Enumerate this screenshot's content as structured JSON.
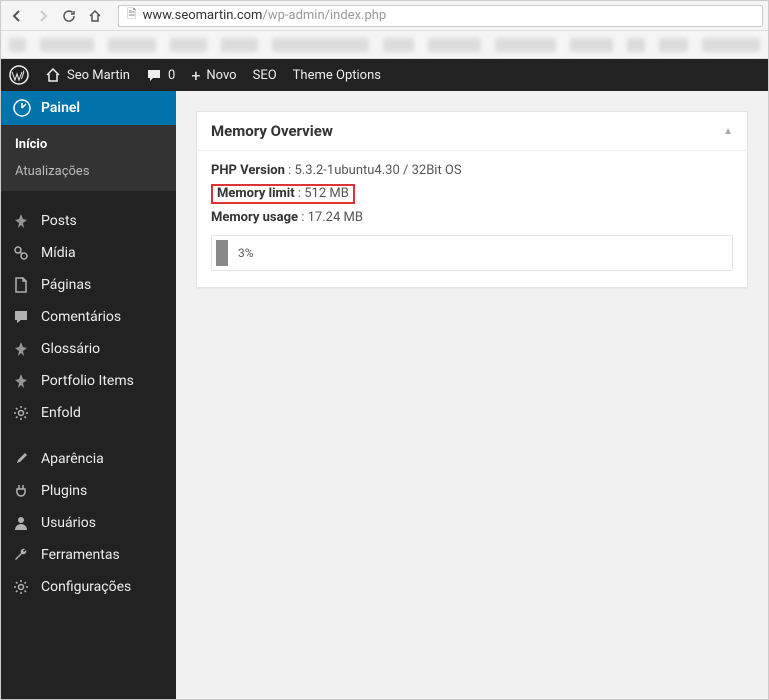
{
  "url": {
    "domain": "www.seomartin.com",
    "path": "/wp-admin/index.php"
  },
  "adminbar": {
    "site_name": "Seo Martin",
    "comments_count": "0",
    "new_label": "Novo",
    "seo_label": "SEO",
    "theme_options_label": "Theme Options"
  },
  "sidebar": {
    "dashboard": "Painel",
    "submenu": {
      "home": "Início",
      "updates": "Atualizações"
    },
    "items": [
      {
        "icon": "pin",
        "label": "Posts"
      },
      {
        "icon": "media",
        "label": "Mídia"
      },
      {
        "icon": "page",
        "label": "Páginas"
      },
      {
        "icon": "comment",
        "label": "Comentários"
      },
      {
        "icon": "pin",
        "label": "Glossário"
      },
      {
        "icon": "pin",
        "label": "Portfolio Items"
      },
      {
        "icon": "gear",
        "label": "Enfold"
      }
    ],
    "items2": [
      {
        "icon": "brush",
        "label": "Aparência"
      },
      {
        "icon": "plug",
        "label": "Plugins"
      },
      {
        "icon": "user",
        "label": "Usuários"
      },
      {
        "icon": "wrench",
        "label": "Ferramentas"
      },
      {
        "icon": "gear",
        "label": "Configurações"
      }
    ]
  },
  "postbox": {
    "title": "Memory Overview",
    "php_label": "PHP Version",
    "php_value": "5.3.2-1ubuntu4.30 / 32Bit OS",
    "limit_label": "Memory limit",
    "limit_value": "512 MB",
    "usage_label": "Memory usage",
    "usage_value": "17.24 MB",
    "percent": "3%"
  }
}
